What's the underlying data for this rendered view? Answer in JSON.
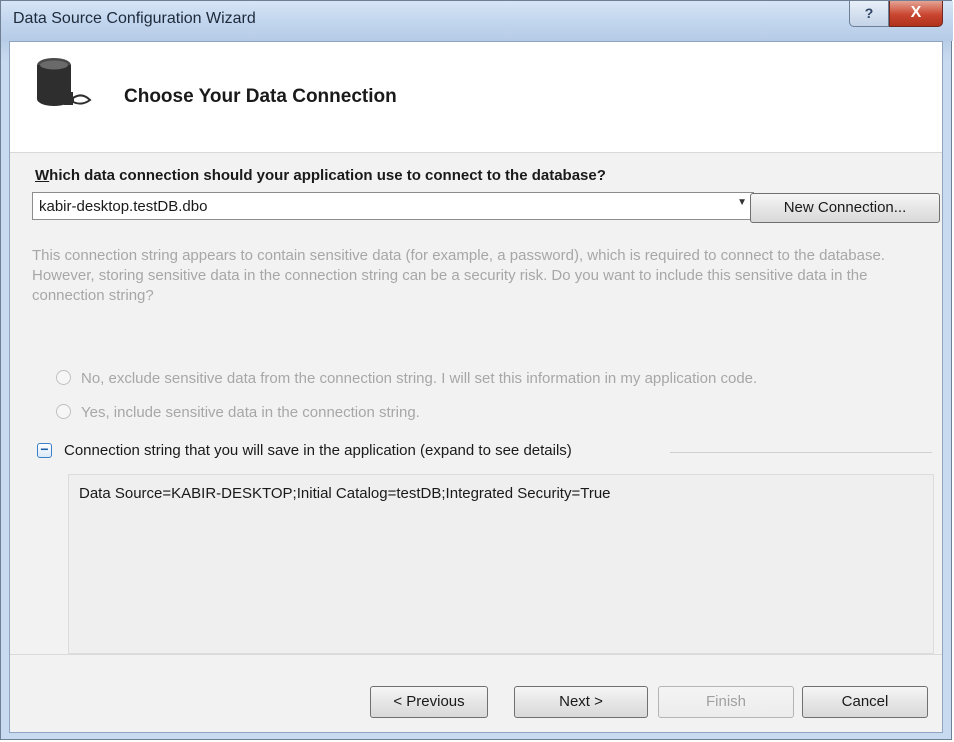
{
  "window": {
    "title": "Data Source Configuration Wizard",
    "help_label": "?",
    "close_label": "X"
  },
  "header": {
    "title": "Choose Your Data Connection",
    "icon": "database-connection-icon"
  },
  "connection": {
    "question_prefix": "W",
    "question_rest": "hich data connection should your application use to connect to the database?",
    "selected_value": "kabir-desktop.testDB.dbo",
    "new_connection_label": "New Connection...",
    "sensitive_info": "This connection string appears to contain sensitive data (for example, a password), which is required to connect to the database. However, storing sensitive data in the connection string can be a security risk. Do you want to include this sensitive data in the connection string?",
    "option_exclude": "No, exclude sensitive data from the connection string. I will set this information in my application code.",
    "option_include": "Yes, include sensitive data in the connection string."
  },
  "details": {
    "expander_symbol": "−",
    "label": "Connection string that you will save in the application (expand to see details)",
    "connection_string": "Data Source=KABIR-DESKTOP;Initial Catalog=testDB;Integrated Security=True"
  },
  "buttons": {
    "previous": "< Previous",
    "next": "Next >",
    "finish": "Finish",
    "cancel": "Cancel"
  },
  "colors": {
    "title_bar": "#c2d6ee",
    "close_button": "#c9452f",
    "disabled_text": "#a7a7a7",
    "expander_blue": "#3a7fc8"
  }
}
